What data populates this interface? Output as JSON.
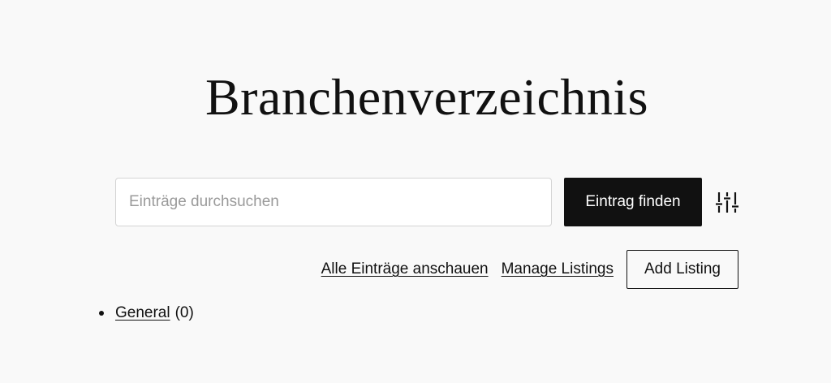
{
  "page": {
    "title": "Branchenverzeichnis"
  },
  "search": {
    "value": "",
    "placeholder": "Einträge durchsuchen",
    "submit_label": "Eintrag finden",
    "filter_icon": "sliders-icon"
  },
  "actions": {
    "view_all_label": "Alle Einträge anschauen",
    "manage_label": "Manage Listings",
    "add_label": "Add Listing"
  },
  "categories": [
    {
      "name": "General",
      "count": "(0)"
    }
  ]
}
